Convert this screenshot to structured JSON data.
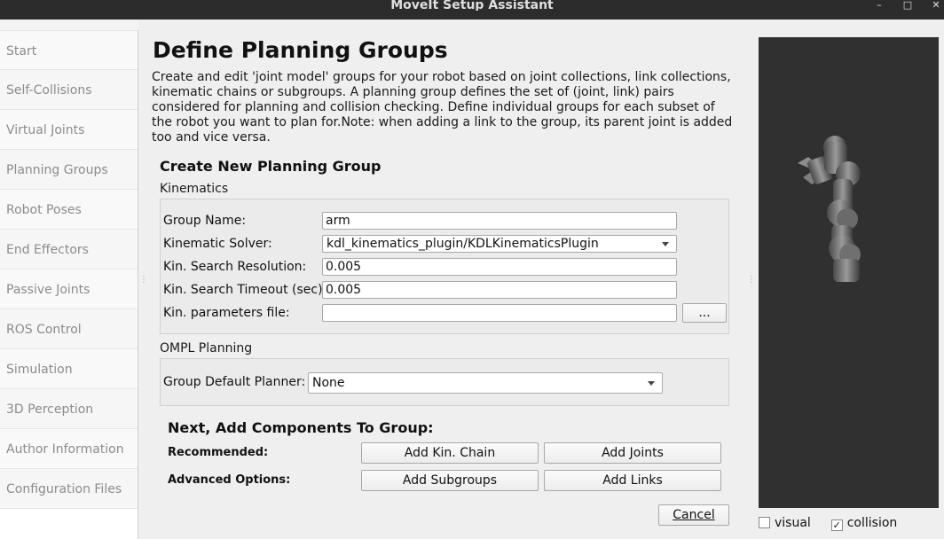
{
  "window": {
    "title": "MoveIt Setup Assistant",
    "controls": [
      "–",
      "□",
      "✕"
    ]
  },
  "sidebar": {
    "items": [
      {
        "label": "Start"
      },
      {
        "label": "Self-Collisions"
      },
      {
        "label": "Virtual Joints"
      },
      {
        "label": "Planning Groups"
      },
      {
        "label": "Robot Poses"
      },
      {
        "label": "End Effectors"
      },
      {
        "label": "Passive Joints"
      },
      {
        "label": "ROS Control"
      },
      {
        "label": "Simulation"
      },
      {
        "label": "3D Perception"
      },
      {
        "label": "Author Information"
      },
      {
        "label": "Configuration Files"
      }
    ]
  },
  "main": {
    "title": "Define Planning Groups",
    "description": "Create and edit 'joint model' groups for your robot based on joint collections, link collections, kinematic chains or subgroups. A planning group defines the set of (joint, link) pairs considered for planning and collision checking. Define individual groups for each subset of the robot you want to plan for.Note: when adding a link to the group, its parent joint is added too and vice versa.",
    "create_heading": "Create New Planning Group",
    "kinematics": {
      "section_label": "Kinematics",
      "group_name_label": "Group Name:",
      "group_name_value": "arm",
      "solver_label": "Kinematic Solver:",
      "solver_value": "kdl_kinematics_plugin/KDLKinematicsPlugin",
      "resolution_label": "Kin. Search Resolution:",
      "resolution_value": "0.005",
      "timeout_label": "Kin. Search Timeout (sec):",
      "timeout_value": "0.005",
      "params_label": "Kin. parameters file:",
      "params_value": "",
      "browse_label": "..."
    },
    "ompl": {
      "section_label": "OMPL Planning",
      "planner_label": "Group Default Planner:",
      "planner_value": "None"
    },
    "components": {
      "heading": "Next, Add Components To Group:",
      "recommended_label": "Recommended:",
      "advanced_label": "Advanced Options:",
      "add_kin_chain": "Add Kin. Chain",
      "add_joints": "Add Joints",
      "add_subgroups": "Add Subgroups",
      "add_links": "Add Links"
    },
    "cancel_label": "Cancel"
  },
  "viewer": {
    "visual_label": "visual",
    "visual_checked": false,
    "collision_label": "collision",
    "collision_checked": true
  },
  "colors": {
    "viewer_background": "#303030",
    "titlebar": "#2c2c2c"
  }
}
